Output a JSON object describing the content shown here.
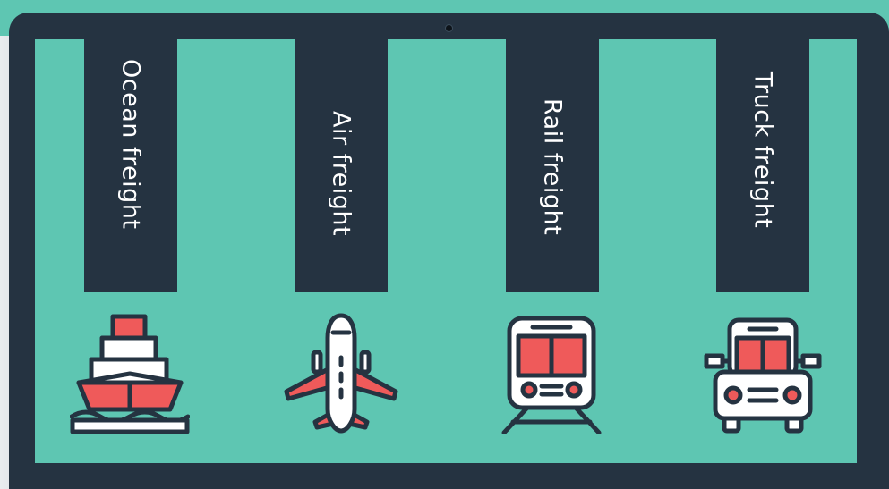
{
  "modes": [
    {
      "label": "Ocean freight",
      "icon": "ship-icon"
    },
    {
      "label": "Air freight",
      "icon": "airplane-icon"
    },
    {
      "label": "Rail freight",
      "icon": "train-icon"
    },
    {
      "label": "Truck freight",
      "icon": "truck-icon"
    }
  ],
  "colors": {
    "background": "#5ec6b2",
    "frame": "#253341",
    "accent": "#ef5a5a",
    "icon_fill": "#ffffff"
  }
}
